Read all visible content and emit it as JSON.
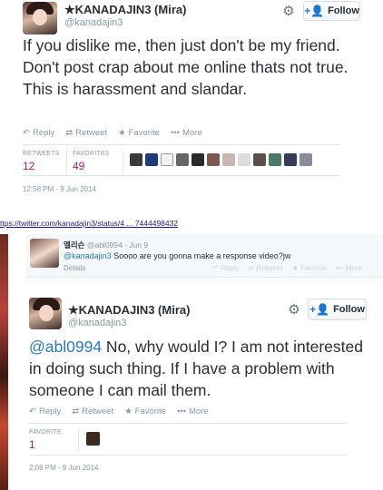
{
  "tweet1": {
    "name": "★KANADAJIN3 (Mira)",
    "handle": "@kanadajin3",
    "follow_label": "Follow",
    "text": "If you dislike me, then just don't be my friend. Don't post crap about me online thats not true. This is harassment and slandar.",
    "actions": [
      "Reply",
      "Retweet",
      "Favorite",
      "More"
    ],
    "stat1_label": "RETWEETS",
    "stat1_value": "12",
    "stat2_label": "FAVORITES",
    "stat2_value": "49",
    "time": "12:58 PM - 9 Jun 2014"
  },
  "url_bar": "ttps://twitter.com/kanadajin3/status/4 ... 7444498432",
  "reply": {
    "name": "엘리슨",
    "meta": "@abl0994 · Jun 9",
    "mention": "@kanadajin3",
    "text": " Soooo are you gonna make a response video?jw",
    "details": "Details",
    "actions": [
      "Reply",
      "Retweet",
      "Favorite",
      "More"
    ]
  },
  "tweet2": {
    "name": "★KANADAJIN3 (Mira)",
    "handle": "@kanadajin3",
    "follow_label": "Follow",
    "mention": "@abl0994",
    "text": " No, why would I? I am not interested in doing such thing. If I have a problem with someone I can mail them.",
    "actions": [
      "Reply",
      "Retweet",
      "Favorite",
      "More"
    ],
    "stat1_label": "FAVORITE",
    "stat1_value": "1",
    "time": "2:08 PM - 9 Jun 2014"
  },
  "colors": {
    "accent": "#2b7bb9",
    "stat_number": "#a3225f",
    "muted": "#8899a6"
  }
}
